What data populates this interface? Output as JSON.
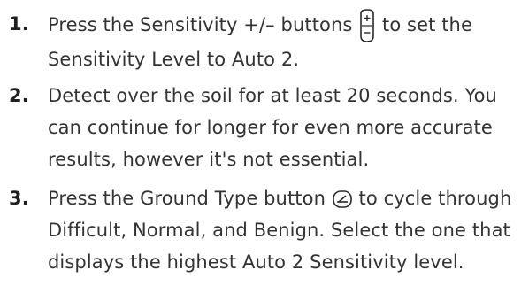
{
  "steps": [
    {
      "number": "1.",
      "text_before_icon": "Press the Sensitivity +/– buttons",
      "icon": "sensitivity-plus-minus-icon",
      "text_after_icon": "to set the Sensitivity Level to Auto 2."
    },
    {
      "number": "2.",
      "text": "Detect over the soil for at least 20 seconds. You can continue for longer for even more accurate results, however it's not essential."
    },
    {
      "number": "3.",
      "text_before_icon": "Press the Ground Type button",
      "icon": "ground-type-icon",
      "text_after_icon": "to cycle through Difficult, Normal, and Benign. Select the one that displays the highest Auto 2 Sensitivity level."
    }
  ],
  "colors": {
    "text": "#333333",
    "number": "#1f1f1f",
    "icon_stroke": "#2a2a2a"
  }
}
